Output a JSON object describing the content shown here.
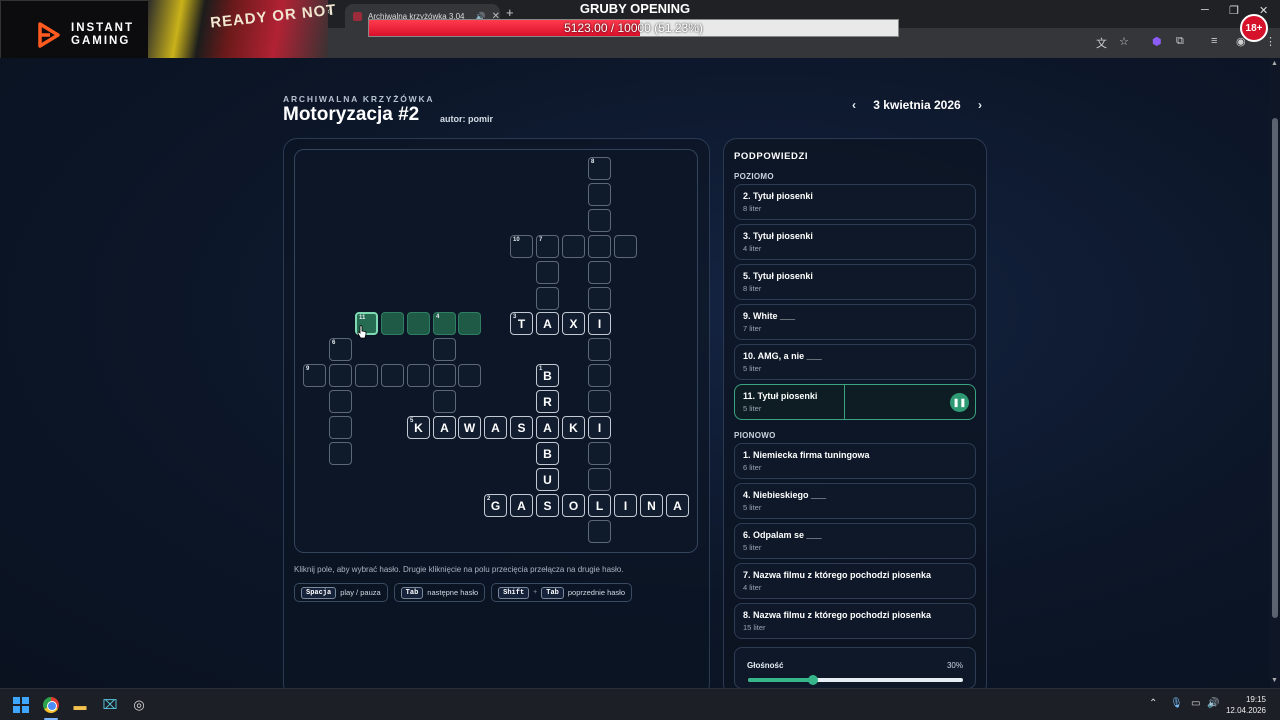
{
  "browser": {
    "tab_title": "Archiwalna krzyżówka 3.04",
    "tab_close": "✕",
    "tab_mute": "🔊",
    "new_tab": "+",
    "back": "‹",
    "win_minimize": "─",
    "win_restore": "❐",
    "win_close": "✕",
    "extensions": [
      "translate-icon",
      "star-icon",
      "extension-icon",
      "puzzle-icon",
      "reading-list-icon",
      "profile-icon",
      "menu-icon"
    ]
  },
  "stream_overlay": {
    "brand_line1": "INSTANT",
    "brand_line2": "GAMING",
    "promo_text": "READY OR NOT",
    "age_badge": "18+",
    "goal_title": "GRUBY OPENING",
    "goal_text": "5123.00 / 10000 (51.23%)",
    "goal_fraction": 0.5123
  },
  "header": {
    "kicker": "ARCHIWALNA KRZYŻÓWKA",
    "title": "Motoryzacja #2",
    "author": "autor: pomir",
    "date": "3 kwietnia 2026",
    "prev": "‹",
    "next": "›"
  },
  "grid": {
    "cells": [
      {
        "r": 0,
        "c": 11,
        "n": "8"
      },
      {
        "r": 1,
        "c": 11
      },
      {
        "r": 2,
        "c": 11
      },
      {
        "r": 3,
        "c": 8,
        "n": "10"
      },
      {
        "r": 3,
        "c": 9,
        "n": "7"
      },
      {
        "r": 3,
        "c": 10
      },
      {
        "r": 3,
        "c": 11
      },
      {
        "r": 3,
        "c": 12
      },
      {
        "r": 4,
        "c": 9
      },
      {
        "r": 4,
        "c": 11
      },
      {
        "r": 5,
        "c": 9
      },
      {
        "r": 5,
        "c": 11
      },
      {
        "r": 6,
        "c": 2,
        "n": "11",
        "s": "active"
      },
      {
        "r": 6,
        "c": 3,
        "s": "hl"
      },
      {
        "r": 6,
        "c": 4,
        "s": "hl"
      },
      {
        "r": 6,
        "c": 5,
        "n": "4",
        "s": "hl"
      },
      {
        "r": 6,
        "c": 6,
        "s": "hl"
      },
      {
        "r": 6,
        "c": 8,
        "n": "3",
        "l": "T"
      },
      {
        "r": 6,
        "c": 9,
        "l": "A"
      },
      {
        "r": 6,
        "c": 10,
        "l": "X"
      },
      {
        "r": 6,
        "c": 11,
        "l": "I"
      },
      {
        "r": 7,
        "c": 1,
        "n": "6"
      },
      {
        "r": 7,
        "c": 5
      },
      {
        "r": 7,
        "c": 11
      },
      {
        "r": 8,
        "c": 0,
        "n": "9"
      },
      {
        "r": 8,
        "c": 1
      },
      {
        "r": 8,
        "c": 2
      },
      {
        "r": 8,
        "c": 3
      },
      {
        "r": 8,
        "c": 4
      },
      {
        "r": 8,
        "c": 5
      },
      {
        "r": 8,
        "c": 6
      },
      {
        "r": 8,
        "c": 9,
        "n": "1",
        "l": "B"
      },
      {
        "r": 8,
        "c": 11
      },
      {
        "r": 9,
        "c": 1
      },
      {
        "r": 9,
        "c": 5
      },
      {
        "r": 9,
        "c": 9,
        "l": "R"
      },
      {
        "r": 9,
        "c": 11
      },
      {
        "r": 10,
        "c": 1
      },
      {
        "r": 10,
        "c": 4,
        "n": "5",
        "l": "K"
      },
      {
        "r": 10,
        "c": 5,
        "l": "A"
      },
      {
        "r": 10,
        "c": 6,
        "l": "W"
      },
      {
        "r": 10,
        "c": 7,
        "l": "A"
      },
      {
        "r": 10,
        "c": 8,
        "l": "S"
      },
      {
        "r": 10,
        "c": 9,
        "l": "A"
      },
      {
        "r": 10,
        "c": 10,
        "l": "K"
      },
      {
        "r": 10,
        "c": 11,
        "l": "I"
      },
      {
        "r": 11,
        "c": 1
      },
      {
        "r": 11,
        "c": 9,
        "l": "B"
      },
      {
        "r": 11,
        "c": 11
      },
      {
        "r": 12,
        "c": 9,
        "l": "U"
      },
      {
        "r": 12,
        "c": 11
      },
      {
        "r": 13,
        "c": 7,
        "n": "2",
        "l": "G"
      },
      {
        "r": 13,
        "c": 8,
        "l": "A"
      },
      {
        "r": 13,
        "c": 9,
        "l": "S"
      },
      {
        "r": 13,
        "c": 10,
        "l": "O"
      },
      {
        "r": 13,
        "c": 11,
        "l": "L"
      },
      {
        "r": 13,
        "c": 12,
        "l": "I"
      },
      {
        "r": 13,
        "c": 13,
        "l": "N"
      },
      {
        "r": 13,
        "c": 14,
        "l": "A"
      },
      {
        "r": 14,
        "c": 11
      }
    ]
  },
  "hint": "Kliknij pole, aby wybrać hasło. Drugie kliknięcie na polu przecięcia przełącza na drugie hasło.",
  "shortcuts": [
    {
      "keys": [
        "Spacja"
      ],
      "label": "play / pauza"
    },
    {
      "keys": [
        "Tab"
      ],
      "label": "następne hasło"
    },
    {
      "keys": [
        "Shift",
        "Tab"
      ],
      "label": "poprzednie hasło"
    }
  ],
  "clues": {
    "title": "PODPOWIEDZI",
    "across_label": "POZIOMO",
    "down_label": "PIONOWO",
    "across": [
      {
        "text": "2. Tytuł piosenki",
        "len": "8 liter"
      },
      {
        "text": "3. Tytuł piosenki",
        "len": "4 liter"
      },
      {
        "text": "5. Tytuł piosenki",
        "len": "8 liter"
      },
      {
        "text": "9. White ___",
        "len": "7 liter"
      },
      {
        "text": "10. AMG, a nie ___",
        "len": "5 liter"
      },
      {
        "text": "11. Tytuł piosenki",
        "len": "5 liter"
      }
    ],
    "down": [
      {
        "text": "1. Niemiecka firma tuningowa",
        "len": "6 liter"
      },
      {
        "text": "4. Niebieskiego ___",
        "len": "5 liter"
      },
      {
        "text": "6. Odpalam se ___",
        "len": "5 liter"
      },
      {
        "text": "7. Nazwa filmu z którego pochodzi piosenka",
        "len": "4 liter"
      },
      {
        "text": "8. Nazwa filmu z którego pochodzi piosenka",
        "len": "15 liter"
      }
    ],
    "pause_icon": "❚❚"
  },
  "volume": {
    "label": "Głośność",
    "value_text": "30%",
    "fraction": 0.3
  },
  "taskbar": {
    "time": "19:15",
    "date": "12.04.2026",
    "tray_arrow": "⌃"
  },
  "colors": {
    "accent": "#36b58b",
    "highlight": "#1f5a46",
    "goal": "#e3172f"
  }
}
